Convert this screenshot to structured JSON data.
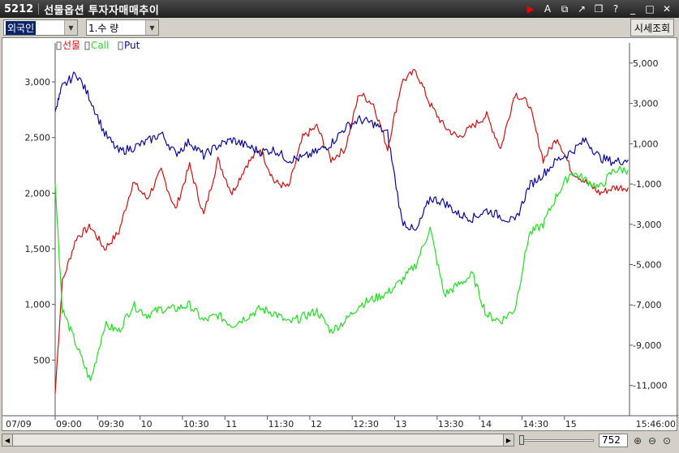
{
  "window": {
    "code": "5212",
    "title": "선물옵션 투자자매매추이",
    "icons": [
      "play-icon",
      "font-icon",
      "export-icon",
      "link-icon",
      "window-icon",
      "help-icon",
      "minimize-icon",
      "maximize-icon",
      "close-icon"
    ]
  },
  "toolbar": {
    "investor_select": "외국인",
    "metric_select": "1.수 량",
    "query_button": "시세조회"
  },
  "status": {
    "zoom_value": "752"
  },
  "colors": {
    "futures": "#cc1010",
    "call": "#22dd22",
    "put": "#0a0a96"
  },
  "chart_data": {
    "type": "line",
    "legend": [
      {
        "name": "선물",
        "axis": "left",
        "color": "#cc1010"
      },
      {
        "name": "Call",
        "axis": "right",
        "color": "#22dd22"
      },
      {
        "name": "Put",
        "axis": "right",
        "color": "#0a0a96"
      }
    ],
    "legend_position": "top-left",
    "grid": false,
    "x_ticks": [
      "07/09",
      "09:00",
      "09:30",
      "10",
      "10:30",
      "11",
      "11:30",
      "12",
      "12:30",
      "13",
      "13:30",
      "14",
      "14:30",
      "15",
      "15:46:00"
    ],
    "left_axis": {
      "ticks": [
        "500",
        "1,000",
        "1,500",
        "2,000",
        "2,500",
        "3,000"
      ],
      "ylim": [
        0,
        3350
      ]
    },
    "right_axis": {
      "ticks": [
        "-11,000",
        "-9,000",
        "-7,000",
        "-5,000",
        "-3,000",
        "-1,000",
        "1,000",
        "3,000",
        "5,000"
      ],
      "ylim": [
        -12500,
        6000
      ]
    },
    "x_time_minutes": [
      0,
      5,
      15,
      25,
      35,
      45,
      55,
      65,
      75,
      85,
      95,
      105,
      115,
      125,
      135,
      145,
      155,
      165,
      175,
      185,
      195,
      205,
      215,
      225,
      235,
      245,
      255,
      265,
      275,
      285,
      295,
      305,
      315,
      325,
      335,
      345,
      355,
      365,
      375,
      385,
      395,
      405
    ],
    "series": [
      {
        "name": "선물",
        "values": [
          200,
          1200,
          1600,
          1700,
          1500,
          1650,
          2100,
          1950,
          2200,
          1850,
          2250,
          1800,
          2300,
          2000,
          2250,
          2400,
          2100,
          2050,
          2500,
          2600,
          2300,
          2400,
          2900,
          2800,
          2400,
          3000,
          3100,
          2800,
          2600,
          2500,
          2600,
          2700,
          2400,
          2900,
          2800,
          2300,
          2500,
          2200,
          2100,
          2000,
          2050,
          2050
        ]
      },
      {
        "name": "Call",
        "values": [
          -1000,
          -7200,
          -9000,
          -10800,
          -8000,
          -8300,
          -7000,
          -7500,
          -7200,
          -7200,
          -7000,
          -7800,
          -7500,
          -8000,
          -7600,
          -7200,
          -7400,
          -7900,
          -7600,
          -7300,
          -8300,
          -7800,
          -7000,
          -6700,
          -6400,
          -5800,
          -5000,
          -3200,
          -6500,
          -6000,
          -5500,
          -7500,
          -7800,
          -7200,
          -3500,
          -3000,
          -1500,
          -400,
          -800,
          -1200,
          -300,
          -300
        ]
      },
      {
        "name": "Put",
        "values": [
          2600,
          3800,
          4500,
          3200,
          1500,
          600,
          800,
          1100,
          1500,
          500,
          1100,
          400,
          900,
          1200,
          900,
          600,
          700,
          200,
          300,
          600,
          1000,
          1800,
          2200,
          2000,
          1500,
          -2800,
          -3400,
          -1700,
          -1900,
          -2500,
          -2700,
          -2300,
          -2600,
          -2900,
          -1100,
          -500,
          200,
          600,
          1200,
          300,
          100,
          200
        ]
      }
    ]
  }
}
